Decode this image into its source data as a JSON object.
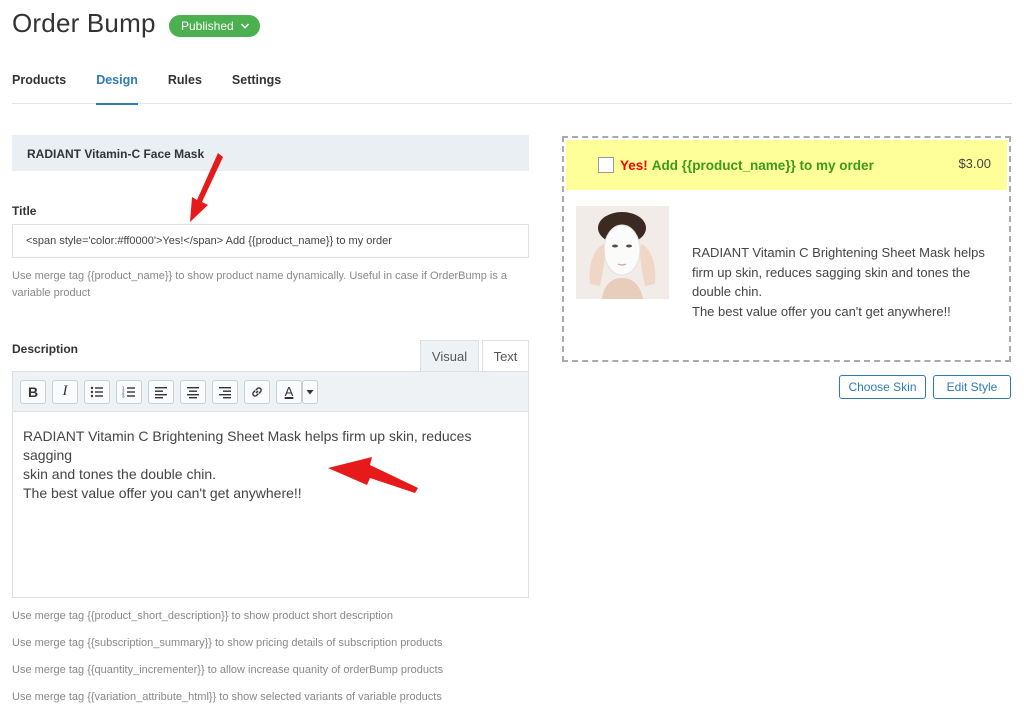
{
  "header": {
    "title": "Order Bump",
    "status": "Published"
  },
  "tabs": [
    {
      "label": "Products",
      "active": false
    },
    {
      "label": "Design",
      "active": true
    },
    {
      "label": "Rules",
      "active": false
    },
    {
      "label": "Settings",
      "active": false
    }
  ],
  "product_bar": {
    "name": "RADIANT Vitamin-C Face Mask"
  },
  "title_field": {
    "label": "Title",
    "value": "<span style='color:#ff0000'>Yes!</span> Add {{product_name}} to my order",
    "help_line1": "Use merge tag {{product_name}} to show product name dynamically. Useful in case if OrderBump is a",
    "help_line2": "variable product"
  },
  "description_field": {
    "label": "Description",
    "tab_visual": "Visual",
    "tab_text": "Text",
    "toolbar": {
      "bold": "B",
      "italic": "I",
      "text_color": "A"
    },
    "content_line1": "RADIANT Vitamin C Brightening Sheet Mask helps firm up skin, reduces sagging",
    "content_line2": "skin and tones the double chin.",
    "content_line3": "The best value offer you can't get anywhere!!"
  },
  "merge_help": [
    "Use merge tag {{product_short_description}} to show product short description",
    "Use merge tag {{subscription_summary}} to show pricing details of subscription products",
    "Use merge tag {{quantity_incrementer}} to allow increase quanity of orderBump products",
    "Use merge tag {{variation_attribute_html}} to show selected variants of variable products"
  ],
  "preview": {
    "yes_text": "Yes!",
    "title": "Add {{product_name}} to my order",
    "price": "$3.00",
    "desc_line1": "RADIANT Vitamin C Brightening Sheet Mask helps",
    "desc_line2": "firm up skin, reduces sagging skin and tones the",
    "desc_line3": "double chin.",
    "desc_line4": "The best value offer you can't get anywhere!!"
  },
  "buttons": {
    "choose_skin": "Choose Skin",
    "edit_style": "Edit Style"
  },
  "colors": {
    "accent": "#2e7bb4",
    "published_badge": "#4caf50",
    "preview_header_bg": "#ffff99",
    "preview_yes": "#ff0000",
    "preview_title": "#3a9a1a",
    "annotation_arrow": "#e61a1a"
  },
  "icons": [
    "chevron-down-icon",
    "bold-icon",
    "italic-icon",
    "bullet-list-icon",
    "numbered-list-icon",
    "align-left-icon",
    "align-center-icon",
    "align-right-icon",
    "link-icon",
    "text-color-icon",
    "dropdown-icon",
    "product-image",
    "annotation-arrow-icon"
  ]
}
